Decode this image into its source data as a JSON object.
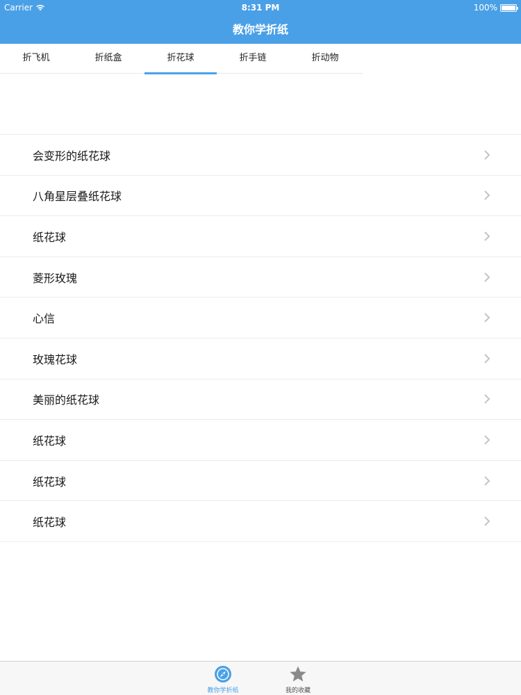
{
  "status_bar": {
    "carrier": "Carrier",
    "time": "8:31 PM",
    "battery": "100%"
  },
  "nav": {
    "title": "教你学折纸"
  },
  "tabs": [
    {
      "label": "折飞机",
      "active": false
    },
    {
      "label": "折纸盒",
      "active": false
    },
    {
      "label": "折花球",
      "active": true
    },
    {
      "label": "折手链",
      "active": false
    },
    {
      "label": "折动物",
      "active": false
    }
  ],
  "list": {
    "items": [
      {
        "label": "会变形的纸花球"
      },
      {
        "label": "八角星层叠纸花球"
      },
      {
        "label": "纸花球"
      },
      {
        "label": "菱形玫瑰"
      },
      {
        "label": "心信"
      },
      {
        "label": "玫瑰花球"
      },
      {
        "label": "美丽的纸花球"
      },
      {
        "label": "纸花球"
      },
      {
        "label": "纸花球"
      },
      {
        "label": "纸花球"
      }
    ]
  },
  "tab_bar": {
    "items": [
      {
        "label": "教你学折纸",
        "icon": "compass-icon",
        "active": true
      },
      {
        "label": "我的收藏",
        "icon": "star-icon",
        "active": false
      }
    ]
  },
  "colors": {
    "accent": "#4aa0e6",
    "tabbar_inactive_icon": "#8a8a8a"
  }
}
